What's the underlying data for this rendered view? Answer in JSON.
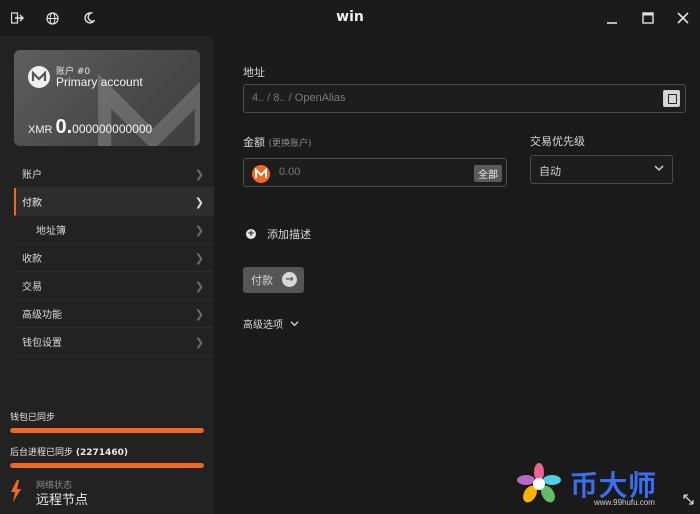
{
  "titlebar": {
    "title": "win",
    "icons": [
      "exit-icon",
      "globe-icon",
      "moon-icon"
    ],
    "window_controls": [
      "minimize-icon",
      "maximize-icon",
      "close-icon"
    ]
  },
  "account_card": {
    "account_number": "账户 #0",
    "account_name": "Primary account",
    "currency": "XMR",
    "balance_int": "0.",
    "balance_dec": "000000000000"
  },
  "menu": {
    "items": [
      {
        "label": "账户"
      },
      {
        "label": "付款"
      },
      {
        "label": "地址簿"
      },
      {
        "label": "收款"
      },
      {
        "label": "交易"
      },
      {
        "label": "高级功能"
      },
      {
        "label": "钱包设置"
      }
    ],
    "active_index": 1
  },
  "sync": {
    "wallet_label": "钱包已同步",
    "wallet_progress": 1.0,
    "daemon_label": "后台进程已同步",
    "daemon_height": "(2271460)",
    "daemon_progress": 1.0
  },
  "network": {
    "caption": "网络状态",
    "value": "远程节点"
  },
  "form": {
    "address_label": "地址",
    "address_placeholder": "4.. / 8.. / OpenAlias",
    "amount_label": "金额",
    "amount_hint": "(更换账户)",
    "amount_placeholder": "0.00",
    "all_button": "全部",
    "priority_label": "交易优先级",
    "priority_value": "自动",
    "add_description": "添加描述",
    "pay_button": "付款",
    "advanced_options": "高级选项"
  },
  "watermark": {
    "text": "币大师",
    "url": "www.99hufu.com"
  },
  "colors": {
    "accent": "#f26822",
    "background": "#1a1a1a",
    "sidebar": "#222222"
  }
}
